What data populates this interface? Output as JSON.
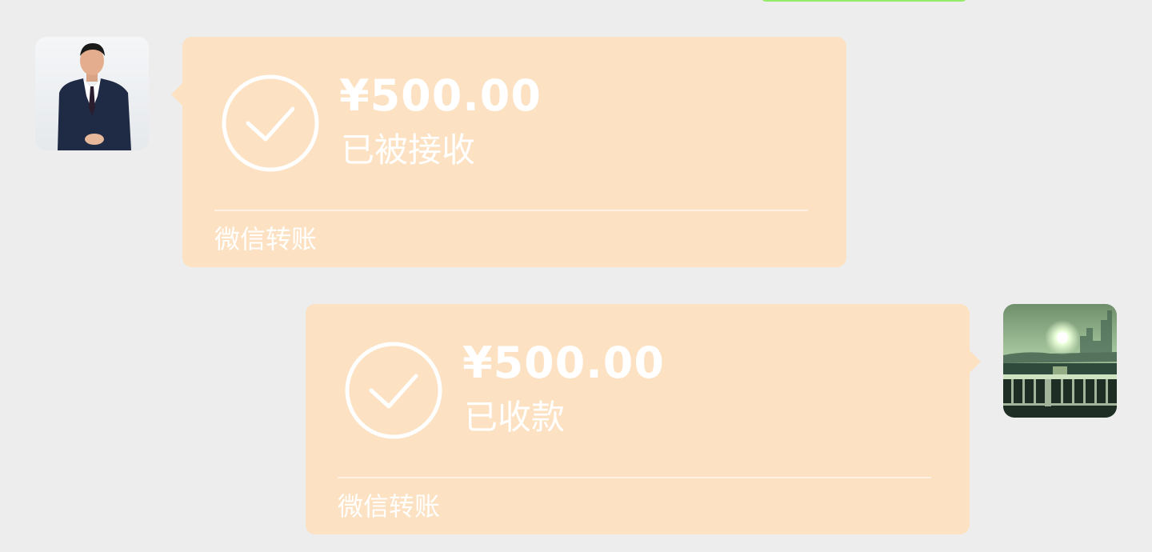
{
  "colors": {
    "background": "#ededed",
    "transfer_bubble": "#fce1c2",
    "sent_bubble": "#95ec69",
    "text": "#ffffff"
  },
  "messages": [
    {
      "side": "left",
      "avatar_icon": "man-in-suit-avatar",
      "status_icon": "check-circle-icon",
      "amount": "¥500.00",
      "status": "已被接收",
      "footer": "微信转账"
    },
    {
      "side": "right",
      "avatar_icon": "sunset-scenery-avatar",
      "status_icon": "check-circle-icon",
      "amount": "¥500.00",
      "status": "已收款",
      "footer": "微信转账"
    }
  ]
}
